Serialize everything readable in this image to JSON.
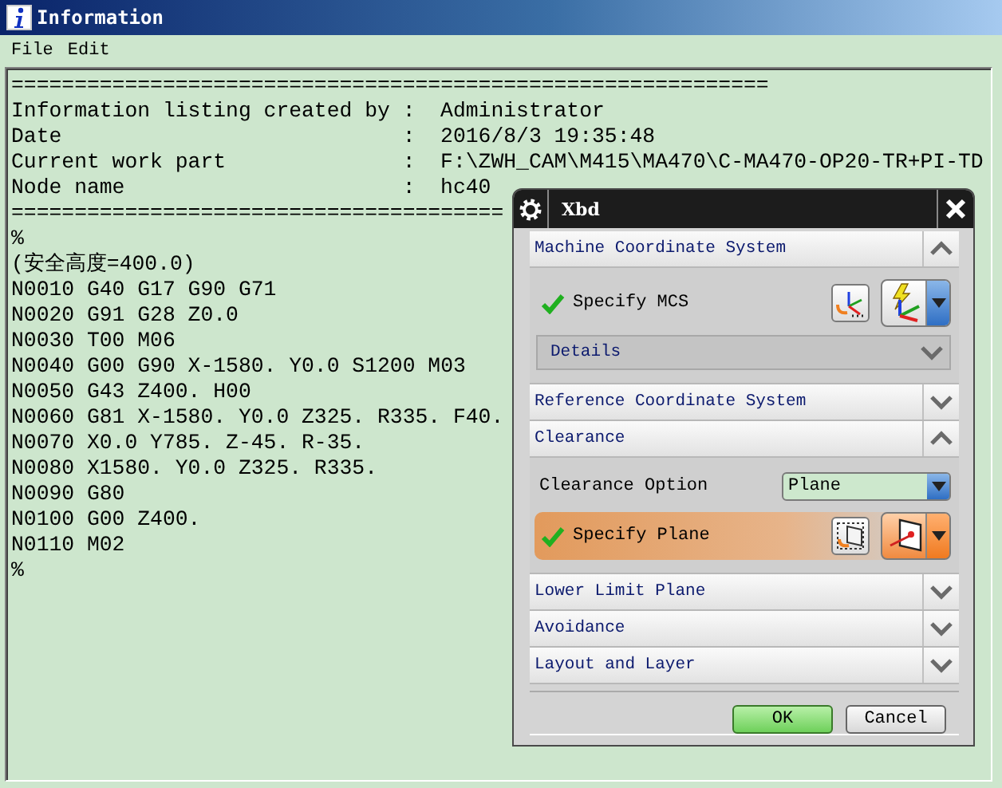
{
  "window": {
    "title": "Information"
  },
  "menu": [
    {
      "label": "File"
    },
    {
      "label": "Edit"
    }
  ],
  "listing": {
    "lines": [
      {
        "kind": "rule",
        "text": "============================================================"
      },
      {
        "kind": "field",
        "label": "Information listing created by",
        "separator": ":",
        "value": "Administrator"
      },
      {
        "kind": "field",
        "label": "Date",
        "separator": ":",
        "value": "2016/8/3 19:35:48"
      },
      {
        "kind": "field",
        "label": "Current work part",
        "separator": ":",
        "value": "F:\\ZWH_CAM\\M415\\MA470\\C-MA470-OP20-TR+PI-TD"
      },
      {
        "kind": "field",
        "label": "Node name",
        "separator": ":",
        "value": "hc40"
      },
      {
        "kind": "rule",
        "text": "======================================="
      },
      {
        "kind": "code",
        "text": "%"
      },
      {
        "kind": "code",
        "text": "(安全高度=400.0)"
      },
      {
        "kind": "code",
        "text": "N0010 G40 G17 G90 G71"
      },
      {
        "kind": "code",
        "text": "N0020 G91 G28 Z0.0"
      },
      {
        "kind": "code",
        "text": "N0030 T00 M06"
      },
      {
        "kind": "code",
        "text": "N0040 G00 G90 X-1580. Y0.0 S1200 M03"
      },
      {
        "kind": "code",
        "text": "N0050 G43 Z400. H00"
      },
      {
        "kind": "code",
        "text": "N0060 G81 X-1580. Y0.0 Z325. R335. F40."
      },
      {
        "kind": "code",
        "text": "N0070 X0.0 Y785. Z-45. R-35."
      },
      {
        "kind": "code",
        "text": "N0080 X1580. Y0.0 Z325. R335."
      },
      {
        "kind": "code",
        "text": "N0090 G80"
      },
      {
        "kind": "code",
        "text": "N0100 G00 Z400."
      },
      {
        "kind": "code",
        "text": "N0110 M02"
      },
      {
        "kind": "code",
        "text": "%"
      }
    ]
  },
  "dialog": {
    "title": "Xbd",
    "sections": [
      {
        "title": "Machine Coordinate System",
        "expanded": true,
        "rows": [
          {
            "kind": "mcs",
            "label": "Specify MCS",
            "done": true,
            "highlighted": false
          },
          {
            "kind": "subsection",
            "label": "Details",
            "expanded": false
          }
        ]
      },
      {
        "title": "Reference Coordinate System",
        "expanded": false
      },
      {
        "title": "Clearance",
        "expanded": true,
        "rows": [
          {
            "kind": "option",
            "label": "Clearance Option",
            "value": "Plane"
          },
          {
            "kind": "plane",
            "label": "Specify Plane",
            "done": true,
            "highlighted": true
          }
        ]
      },
      {
        "title": "Lower Limit Plane",
        "expanded": false
      },
      {
        "title": "Avoidance",
        "expanded": false
      },
      {
        "title": "Layout and Layer",
        "expanded": false
      }
    ],
    "buttons": [
      {
        "label": "OK",
        "default": true
      },
      {
        "label": "Cancel",
        "default": false
      }
    ]
  }
}
